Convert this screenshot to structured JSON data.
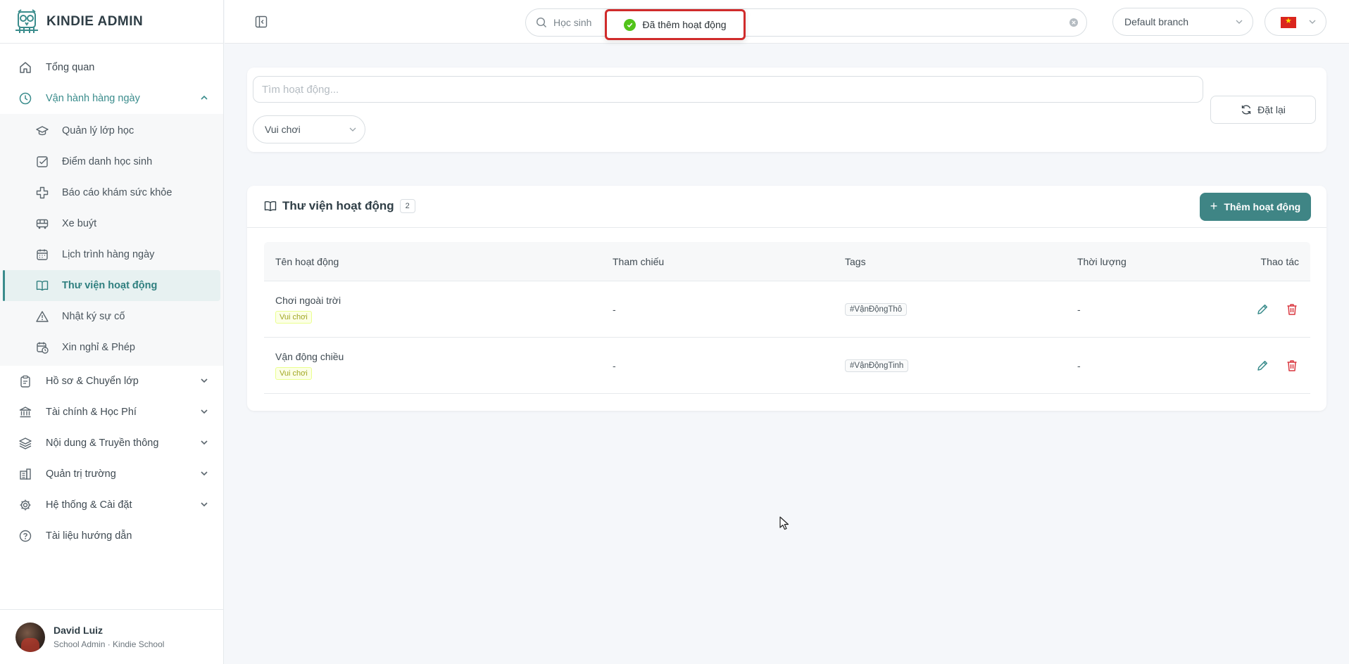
{
  "brand": {
    "name": "KINDIE ADMIN"
  },
  "sidebar": {
    "top_items": [
      {
        "label": "Tổng quan",
        "icon": "home-icon"
      },
      {
        "label": "Vận hành hàng ngày",
        "icon": "clock-icon"
      }
    ],
    "sub_items": [
      {
        "label": "Quản lý lớp học",
        "icon": "graduation-cap-icon"
      },
      {
        "label": "Điểm danh học sinh",
        "icon": "checkbox-icon"
      },
      {
        "label": "Báo cáo khám sức khỏe",
        "icon": "health-cross-icon"
      },
      {
        "label": "Xe buýt",
        "icon": "bus-icon"
      },
      {
        "label": "Lịch trình hàng ngày",
        "icon": "calendar-icon"
      },
      {
        "label": "Thư viện hoạt động",
        "icon": "book-icon"
      },
      {
        "label": "Nhật ký sự cố",
        "icon": "warning-icon"
      },
      {
        "label": "Xin nghỉ & Phép",
        "icon": "calendar-clock-icon"
      }
    ],
    "bottom_items": [
      {
        "label": "Hồ sơ & Chuyển lớp",
        "icon": "clipboard-icon"
      },
      {
        "label": "Tài chính & Học Phí",
        "icon": "bank-icon"
      },
      {
        "label": "Nội dung & Truyền thông",
        "icon": "layers-icon"
      },
      {
        "label": "Quản trị trường",
        "icon": "building-icon"
      },
      {
        "label": "Hệ thống & Cài đặt",
        "icon": "gear-icon"
      },
      {
        "label": "Tài liệu hướng dẫn",
        "icon": "help-circle-icon"
      }
    ],
    "user": {
      "name": "David Luiz",
      "role": "School Admin · Kindie School"
    }
  },
  "header": {
    "search_placeholder": "Học sinh",
    "toast": "Đã thêm hoạt động",
    "branch": "Default branch"
  },
  "filters": {
    "search_placeholder": "Tìm hoạt động...",
    "category": "Vui chơi",
    "reset_label": "Đặt lại"
  },
  "library": {
    "title": "Thư viện hoạt động",
    "count": "2",
    "add_label": "Thêm hoạt động",
    "columns": [
      "Tên hoạt động",
      "Tham chiếu",
      "Tags",
      "Thời lượng",
      "Thao tác"
    ],
    "rows": [
      {
        "name": "Chơi ngoài trời",
        "category": "Vui chơi",
        "reference": "-",
        "tag": "#VậnĐộngThô",
        "duration": "-"
      },
      {
        "name": "Vận động chiều",
        "category": "Vui chơi",
        "reference": "-",
        "tag": "#VậnĐộngTinh",
        "duration": "-"
      }
    ]
  },
  "colors": {
    "accent": "#3f8585",
    "active_bg": "#e7f1f1",
    "danger": "#d9363e",
    "toast_border": "#d02b2b"
  }
}
